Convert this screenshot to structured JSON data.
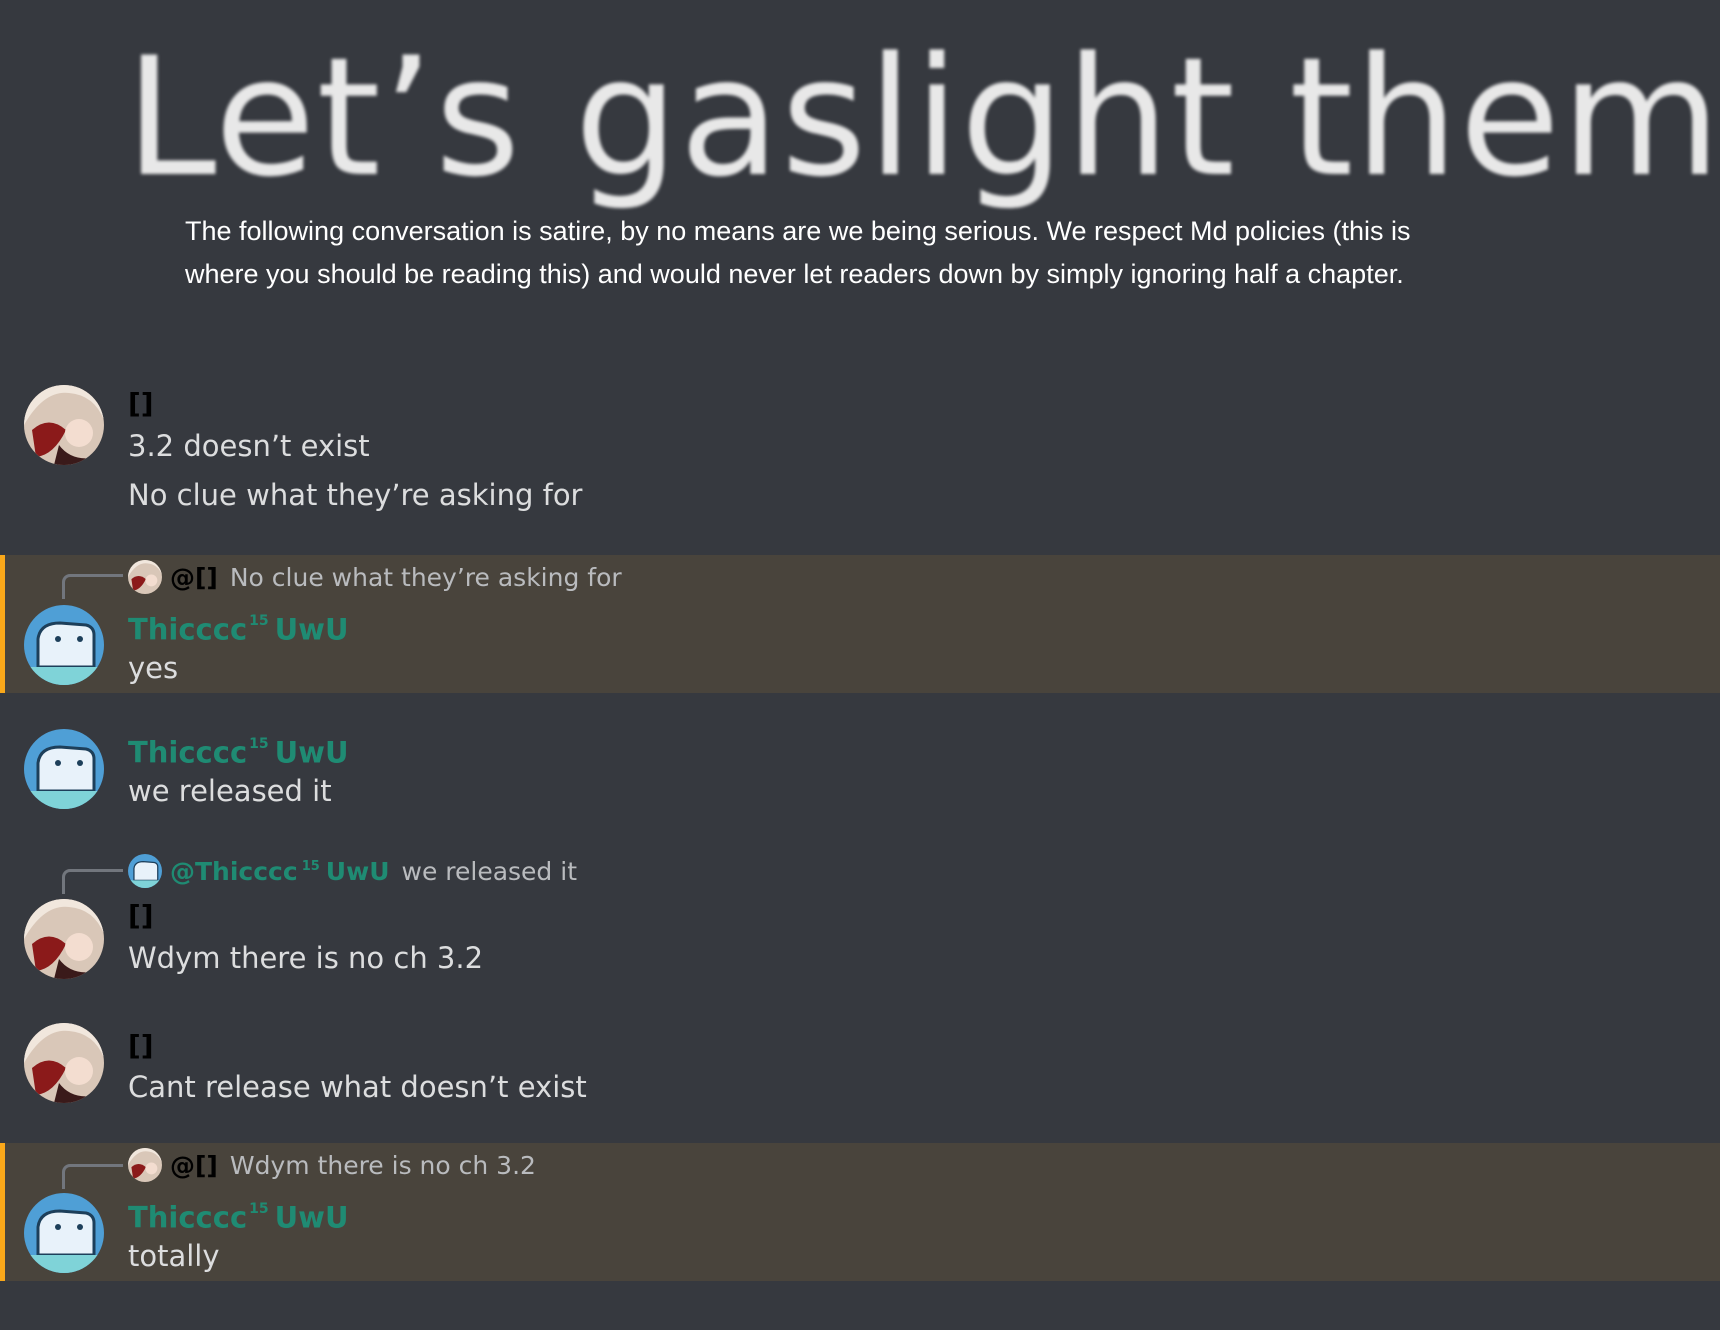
{
  "header": {
    "title": "Let’s gaslight them:",
    "disclaimer": "The following conversation is satire, by no means are we being serious. We respect Md policies (this is where you should be reading this) and would never let readers down by simply ignoring half a chapter."
  },
  "messages": [
    {
      "user": "[]",
      "lines": [
        "3.2 doesn’t exist",
        "No clue what they’re asking for"
      ]
    },
    {
      "reply_to_user": "@[]",
      "reply_text": "No clue what they’re asking for",
      "user": "Thicccc",
      "badge": "15",
      "user_suffix": "UwU",
      "lines": [
        "yes"
      ]
    },
    {
      "user": "Thicccc",
      "badge": "15",
      "user_suffix": "UwU",
      "lines": [
        "we released it"
      ]
    },
    {
      "reply_to_user": "@Thicccc",
      "reply_badge": "15",
      "reply_suffix": "UwU",
      "reply_text": "we released it",
      "user": "[]",
      "lines": [
        "Wdym there is no ch 3.2"
      ]
    },
    {
      "user": "[]",
      "lines": [
        "Cant release what doesn’t exist"
      ]
    },
    {
      "reply_to_user": "@[]",
      "reply_text": "Wdym there is no ch 3.2",
      "user": "Thicccc",
      "badge": "15",
      "user_suffix": "UwU",
      "lines": [
        "totally"
      ]
    }
  ],
  "colors": {
    "background": "#36393f",
    "mention_highlight": "#49443c",
    "mention_bar": "#faa81a",
    "username_green": "#1f8b73",
    "text": "#dcddde"
  },
  "icons": {
    "avatar_a": "anime-girl-avatar-icon",
    "avatar_b": "blue-creature-avatar-icon"
  }
}
